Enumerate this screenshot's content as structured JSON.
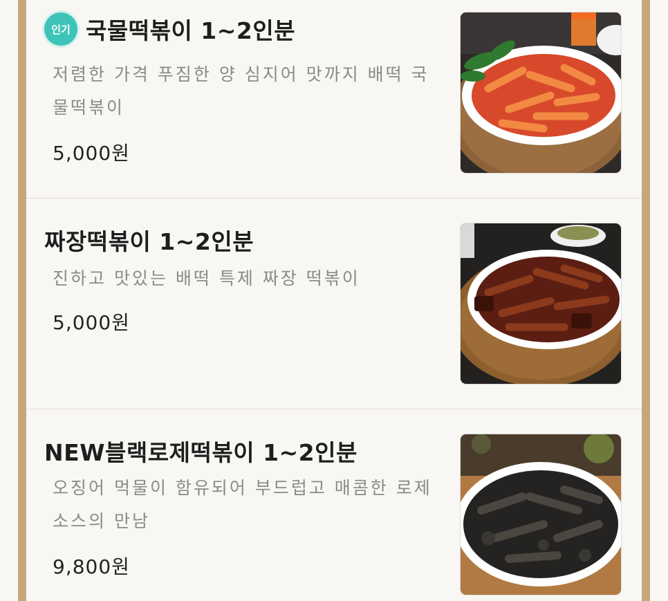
{
  "menu": {
    "items": [
      {
        "badge": "인기",
        "name": "국물떡볶이 1~2인분",
        "description": "저렴한 가격 푸짐한 양 심지어 맛까지  배떡 국물떡볶이",
        "price": "5,000원",
        "photo_icon": "red-tteokbokki-dish-photo"
      },
      {
        "name": "짜장떡볶이 1~2인분",
        "description": "진하고 맛있는 배떡 특제 짜장 떡볶이",
        "price": "5,000원",
        "photo_icon": "jjajang-tteokbokki-dish-photo"
      },
      {
        "name": "NEW블랙로제떡볶이 1~2인분",
        "description": "오징어 먹물이 함유되어 부드럽고 매콤한 로제 소스의 만남",
        "price": "9,800원",
        "photo_icon": "black-rose-tteokbokki-dish-photo"
      }
    ]
  },
  "colors": {
    "frame": "#c9a57a",
    "badge": "#3ec3b8",
    "card_bg": "#f8f7f3",
    "description": "#8a8a8a"
  }
}
